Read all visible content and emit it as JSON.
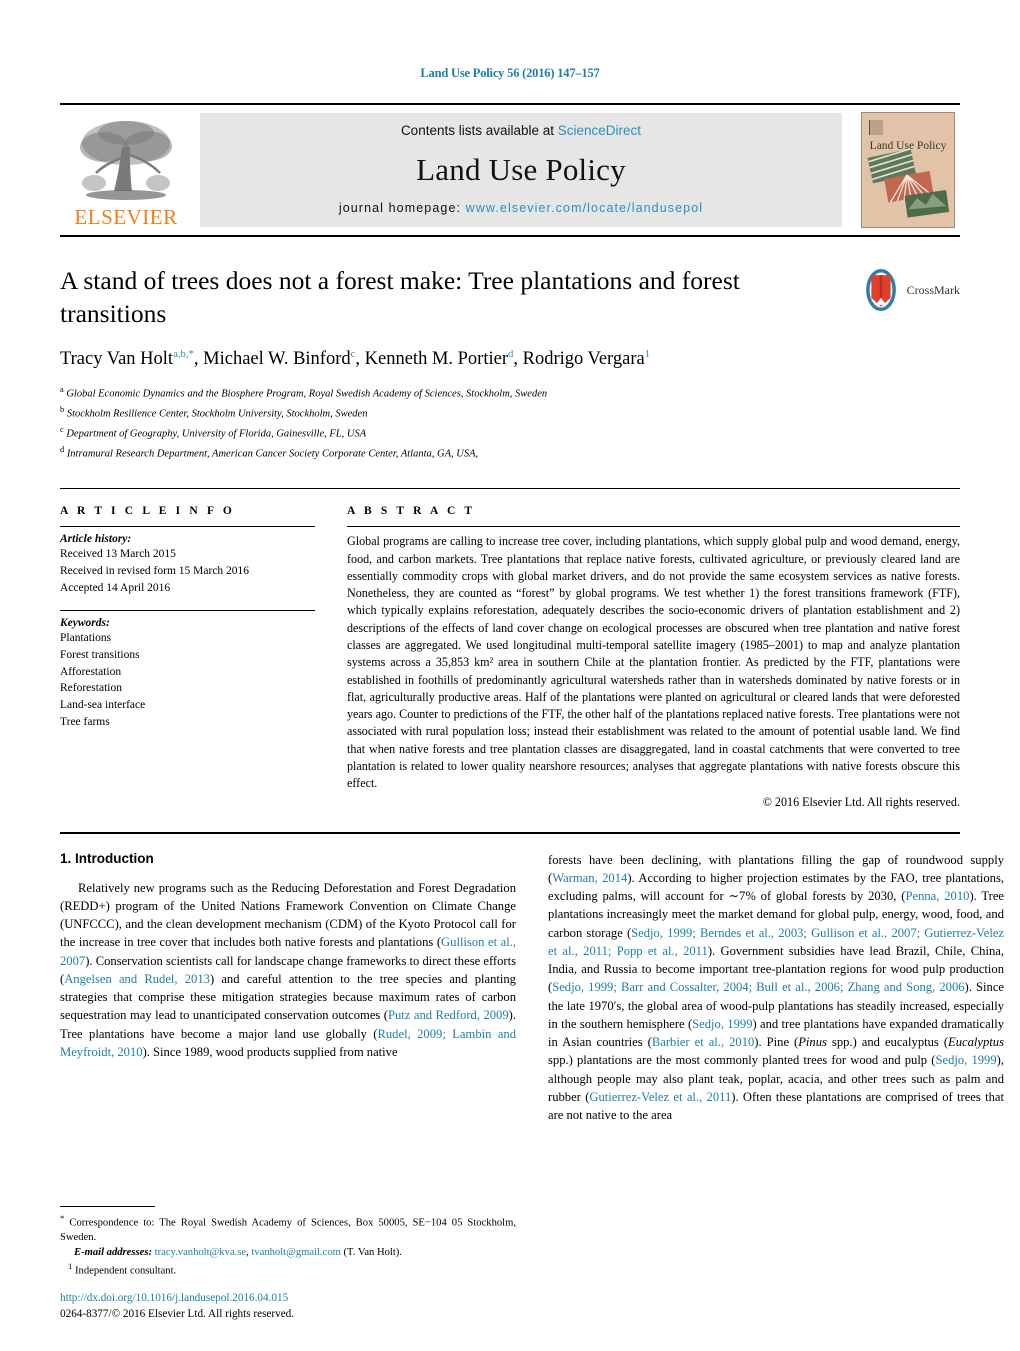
{
  "running_head": "Land Use Policy 56 (2016) 147–157",
  "masthead": {
    "publisher_name": "ELSEVIER",
    "contents_prefix": "Contents lists available at ",
    "contents_link": "ScienceDirect",
    "journal_name": "Land Use Policy",
    "homepage_prefix": "journal homepage: ",
    "homepage_url": "www.elsevier.com/locate/landusepol",
    "cover_title": "Land Use Policy"
  },
  "article": {
    "title": "A stand of trees does not a forest make: Tree plantations and forest transitions",
    "crossmark_label": "CrossMark",
    "authors_html": "Tracy Van Holt<sup>a,b,</sup><sup>*</sup>, Michael W. Binford<sup>c</sup>, Kenneth M. Portier<sup>d</sup>, Rodrigo Vergara<sup>1</sup>",
    "affiliations": [
      {
        "marker": "a",
        "text": "Global Economic Dynamics and the Biosphere Program, Royal Swedish Academy of Sciences, Stockholm, Sweden"
      },
      {
        "marker": "b",
        "text": "Stockholm Resilience Center, Stockholm University, Stockholm, Sweden"
      },
      {
        "marker": "c",
        "text": "Department of Geography, University of Florida, Gainesville, FL, USA"
      },
      {
        "marker": "d",
        "text": "Intramural Research Department, American Cancer Society Corporate Center, Atlanta, GA, USA,"
      }
    ]
  },
  "article_info": {
    "heading": "A R T I C L E   I N F O",
    "history_label": "Article history:",
    "history": [
      "Received 13 March 2015",
      "Received in revised form 15 March 2016",
      "Accepted 14 April 2016"
    ],
    "keywords_label": "Keywords:",
    "keywords": [
      "Plantations",
      "Forest transitions",
      "Afforestation",
      "Reforestation",
      "Land-sea interface",
      "Tree farms"
    ]
  },
  "abstract": {
    "heading": "A B S T R A C T",
    "text": "Global programs are calling to increase tree cover, including plantations, which supply global pulp and wood demand, energy, food, and carbon markets. Tree plantations that replace native forests, cultivated agriculture, or previously cleared land are essentially commodity crops with global market drivers, and do not provide the same ecosystem services as native forests. Nonetheless, they are counted as “forest” by global programs. We test whether 1) the forest transitions framework (FTF), which typically explains reforestation, adequately describes the socio-economic drivers of plantation establishment and 2) descriptions of the effects of land cover change on ecological processes are obscured when tree plantation and native forest classes are aggregated. We used longitudinal multi-temporal satellite imagery (1985–2001) to map and analyze plantation systems across a 35,853 km² area in southern Chile at the plantation frontier. As predicted by the FTF, plantations were established in foothills of predominantly agricultural watersheds rather than in watersheds dominated by native forests or in flat, agriculturally productive areas. Half of the plantations were planted on agricultural or cleared lands that were deforested years ago. Counter to predictions of the FTF, the other half of the plantations replaced native forests. Tree plantations were not associated with rural population loss; instead their establishment was related to the amount of potential usable land. We find that when native forests and tree plantation classes are disaggregated, land in coastal catchments that were converted to tree plantation is related to lower quality nearshore resources; analyses that aggregate plantations with native forests obscure this effect.",
    "copyright": "© 2016 Elsevier Ltd. All rights reserved."
  },
  "body": {
    "section_title": "1.  Introduction",
    "left_para_html": "Relatively new programs such as the Reducing Deforestation and Forest Degradation (REDD+) program of the United Nations Framework Convention on Climate Change (UNFCCC), and the clean development mechanism (CDM) of the Kyoto Protocol call for the increase in tree cover that includes both native forests and plantations (<span class=\"ref\">Gullison et al., 2007</span>). Conservation scientists call for landscape change frameworks to direct these efforts (<span class=\"ref\">Angelsen and Rudel, 2013</span>) and careful attention to the tree species and planting strategies that comprise these mitigation strategies because maximum rates of carbon sequestration may lead to unanticipated conservation outcomes (<span class=\"ref\">Putz and Redford, 2009</span>). Tree plantations have become a major land use globally (<span class=\"ref\">Rudel, 2009; Lambin and Meyfroidt, 2010</span>). Since 1989, wood products supplied from native",
    "right_para_html": "forests have been declining, with plantations filling the gap of roundwood supply (<span class=\"ref\">Warman, 2014</span>). According to higher projection estimates by the FAO, tree plantations, excluding palms, will account for ∼7% of global forests by 2030, (<span class=\"ref\">Penna, 2010</span>). Tree plantations increasingly meet the market demand for global pulp, energy, wood, food, and carbon storage (<span class=\"ref\">Sedjo, 1999; Berndes et al., 2003; Gullison et al., 2007; Gutierrez-Velez et al., 2011; Popp et al., 2011</span>). Government subsidies have lead Brazil, Chile, China, India, and Russia to become important tree-plantation regions for wood pulp production (<span class=\"ref\">Sedjo, 1999; Barr and Cossalter, 2004; Bull et al., 2006; Zhang and Song, 2006</span>). Since the late 1970′s, the global area of wood-pulp plantations has steadily increased, especially in the southern hemisphere (<span class=\"ref\">Sedjo, 1999</span>) and tree plantations have expanded dramatically in Asian countries (<span class=\"ref\">Barbier et al., 2010</span>). Pine (<i>Pinus</i> spp.) and eucalyptus (<i>Eucalyptus</i> spp.) plantations are the most commonly planted trees for wood and pulp (<span class=\"ref\">Sedjo, 1999</span>), although people may also plant teak, poplar, acacia, and other trees such as palm and rubber (<span class=\"ref\">Gutierrez-Velez et al., 2011</span>). Often these plantations are comprised of trees that are not native to the area"
  },
  "footnotes": {
    "correspondence_html": "<sup>*</sup> Correspondence to: The Royal Swedish Academy of Sciences, Box 50005, SE−104 05 Stockholm, Sweden.",
    "email_html": "<span class=\"em\">E-mail addresses:</span> <span class=\"ref\">tracy.vanholt@kva.se</span>, <span class=\"ref\">tvanholt@gmail.com</span> (T. Van Holt).",
    "independent_html": "<sup>1</sup> Independent consultant."
  },
  "doi_block": {
    "doi_url": "http://dx.doi.org/10.1016/j.landusepol.2016.04.015",
    "issn_line": "0264-8377/© 2016 Elsevier Ltd. All rights reserved."
  },
  "colors": {
    "link": "#1b7fa8",
    "elsevier_orange": "#F07F1A",
    "cover_bg": "#e3c3a8",
    "band_bg": "#e6e6e6"
  }
}
